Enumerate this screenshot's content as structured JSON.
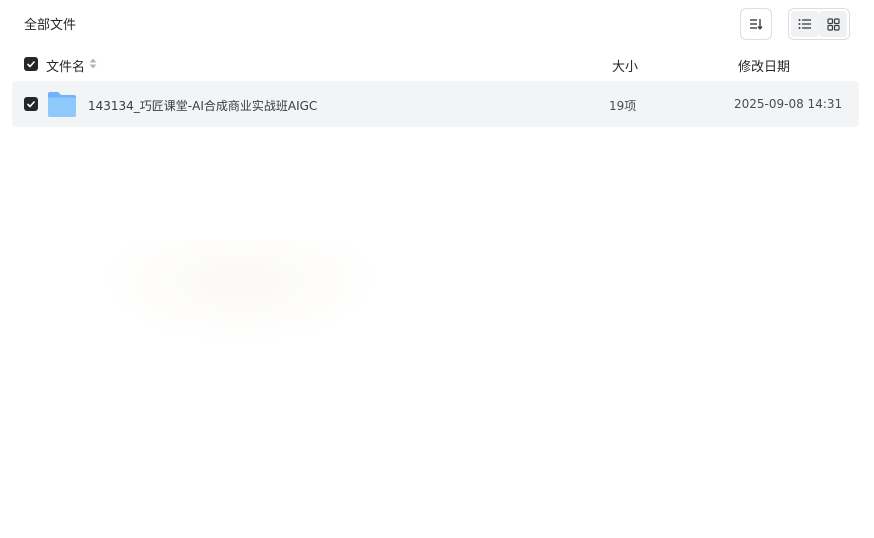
{
  "header": {
    "title": "全部文件",
    "sort_icon": "sort-icon",
    "view_list_icon": "list-view-icon",
    "view_grid_icon": "grid-view-icon",
    "active_view": "list"
  },
  "columns": {
    "name": "文件名",
    "size": "大小",
    "date": "修改日期"
  },
  "files": [
    {
      "name": "143134_巧匠课堂-AI合成商业实战班AIGC",
      "size": "19项",
      "modified": "2025-09-08 14:31",
      "type_icon": "folder-icon",
      "checked": true
    }
  ],
  "colors": {
    "checkbox": "#25262b",
    "row_selected_bg": "#f3f4f6",
    "folder_top": "#6fb5f5",
    "folder_body": "#8cc7fa"
  }
}
